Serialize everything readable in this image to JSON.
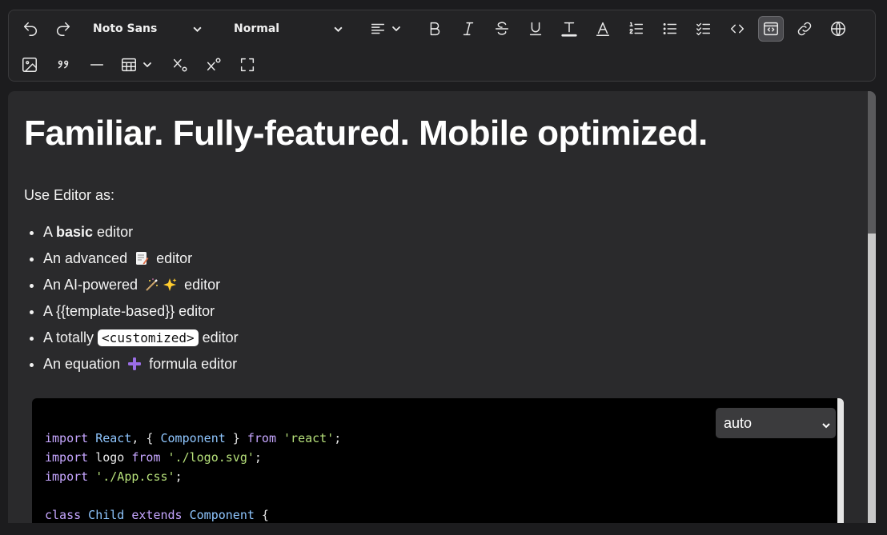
{
  "toolbar": {
    "font_family": "Noto Sans",
    "block_style": "Normal",
    "row1_icons": [
      "undo-icon",
      "redo-icon",
      "align-left-icon",
      "bold-icon",
      "italic-icon",
      "strikethrough-icon",
      "underline-icon",
      "text-color-icon",
      "highlight-icon",
      "ordered-list-icon",
      "bullet-list-icon",
      "checklist-icon",
      "code-icon",
      "code-block-icon",
      "link-icon",
      "globe-icon"
    ],
    "row2_icons": [
      "image-icon",
      "quote-icon",
      "horizontal-rule-icon",
      "table-icon",
      "subscript-icon",
      "superscript-icon",
      "fullscreen-icon"
    ]
  },
  "editor": {
    "heading": "Familiar. Fully-featured. Mobile optimized.",
    "intro": "Use Editor as:",
    "items": {
      "i1_pre": "A ",
      "i1_bold": "basic",
      "i1_post": " editor",
      "i2_pre": "An advanced",
      "i2_post": "editor",
      "i3_pre": "An AI-powered",
      "i3_post": "editor",
      "i4": "A {{template-based}} editor",
      "i5_pre": "A totally ",
      "i5_code": "<customized>",
      "i5_post": " editor",
      "i6_pre": "An equation",
      "i6_post": "formula editor"
    },
    "code_block": {
      "language": "auto",
      "lines": {
        "l1_a": "import",
        "l1_b": " React",
        "l1_c": ", { ",
        "l1_d": "Component",
        "l1_e": " } ",
        "l1_f": "from",
        "l1_g": " 'react'",
        "l1_h": ";",
        "l2_a": "import",
        "l2_b": " logo ",
        "l2_c": "from",
        "l2_d": " './logo.svg'",
        "l2_e": ";",
        "l3_a": "import",
        "l3_b": " './App.css'",
        "l3_c": ";",
        "l5_a": "class",
        "l5_b": " Child",
        "l5_c": " extends",
        "l5_d": " Component",
        "l5_e": " {"
      }
    }
  }
}
